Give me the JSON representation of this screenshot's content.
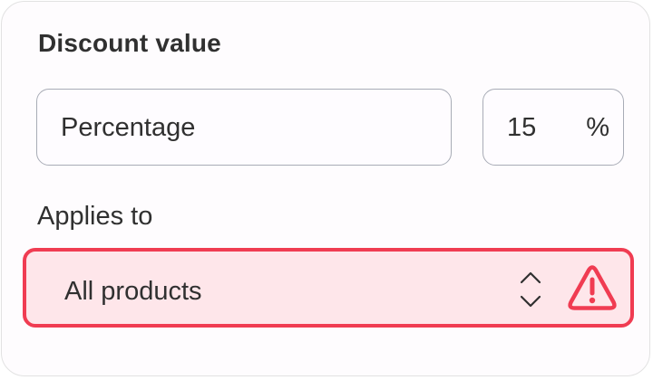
{
  "discount": {
    "section_title": "Discount value",
    "type_value": "Percentage",
    "amount_value": "15",
    "amount_suffix": "%"
  },
  "applies_to": {
    "label": "Applies to",
    "selected": "All products",
    "status": "error"
  },
  "colors": {
    "error_border": "#f03c52",
    "error_background": "#fee6ea",
    "field_border": "#a8acb6",
    "text": "#303030"
  },
  "icons": {
    "select": "chevron-up-down-icon",
    "status": "warning-triangle-icon"
  }
}
